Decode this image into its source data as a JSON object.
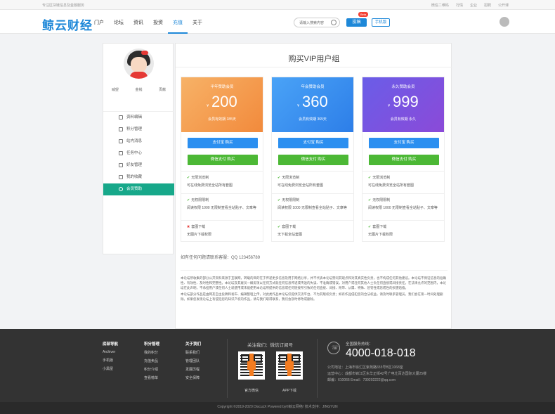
{
  "topbar": {
    "tagline": "专注区块链信息及金融服务",
    "links": [
      "微信二维码",
      "行情",
      "企业",
      "招聘",
      "公开课"
    ]
  },
  "nav": {
    "logo": "鲸云财经",
    "items": [
      "门户",
      "论坛",
      "资讯",
      "投资",
      "充值",
      "关于"
    ],
    "active": "充值",
    "search_placeholder": "请输入搜索内容",
    "post": "投稿",
    "beta": "Beta",
    "mobile": "手机版"
  },
  "sidebar": {
    "stats": [
      "威望",
      "金钱",
      "贡献"
    ],
    "menu": [
      "资料编辑",
      "积分管理",
      "站内消息",
      "任务中心",
      "好友管理",
      "我的收藏",
      "会员赞助"
    ],
    "active": "会员赞助"
  },
  "main": {
    "title": "购买VIP用户组",
    "cards": [
      {
        "name": "半年赞助会员",
        "currency": "¥",
        "price": "200",
        "sub": "会员有效期 185天",
        "alipay": "支付宝 购买",
        "wechat": "微信支付 购买",
        "features": [
          {
            "ok": true,
            "head": "无限浏览制",
            "desc": "可在线免费浏览全站所有套图"
          },
          {
            "ok": true,
            "head": "无权限限制",
            "desc": "阅读权限 1000 无限制查看全站贴子、文章等"
          },
          {
            "ok": false,
            "head": "套图下载",
            "desc": "无图片下载权限"
          }
        ]
      },
      {
        "name": "年会赞助会员",
        "currency": "¥",
        "price": "360",
        "sub": "会员有效期 365天",
        "alipay": "支付宝 购买",
        "wechat": "微信支付 购买",
        "features": [
          {
            "ok": true,
            "head": "无限浏览制",
            "desc": "可在线免费浏览全站所有套图"
          },
          {
            "ok": true,
            "head": "无权限限制",
            "desc": "阅读权限 1000 无限制查看全站贴子、文章等"
          },
          {
            "ok": true,
            "head": "套图下载",
            "desc": "无下载全站套图"
          }
        ]
      },
      {
        "name": "永久赞助会员",
        "currency": "¥",
        "price": "999",
        "sub": "会员有效期 永久",
        "alipay": "支付宝 购买",
        "wechat": "微信支付 购买",
        "features": [
          {
            "ok": true,
            "head": "无限浏览制",
            "desc": "可在线免费浏览全站所有套图"
          },
          {
            "ok": true,
            "head": "无权限限制",
            "desc": "阅读权限 1000 无限制查看全站贴子、文章等"
          },
          {
            "ok": true,
            "head": "套图下载",
            "desc": "无图片下载权限"
          }
        ]
      }
    ],
    "contact": "如有任何问题请联系客服：QQ 123456789",
    "note1": "本论坛所收集的部分公开资料来源于互联网，转载的目的在于传递更多信息及用于网络分享，并不代表本论坛赞同其观点和对其真实性负责，也不构成任何其他建议。本论坛不保证信息的准确性、有效性、及时性和完整性。本论坛及其雇员一概毋须以任何方式就任何信息传递或传送的失误、不准确或错误，对用户或任何其他人士负任何直接或间接责任。在法律允许的范围内，本论坛在此声明，不承担用户或任何人士就使用或未能使用本论坛所提供的信息或任何链接所引致的任何直接、间接、附带、从属、特殊、惩罚性或惩戒性的损害赔偿。",
    "note2": "本论坛部分作品是由网友自主投稿和发布、编辑整理上传，对此类作品本论坛仅提供交流平台，不为其版权负责；如有作品侵犯您的合法权益，请及时联系管理员，我们会在第一时间处理删除。如果您发现论坛上有侵犯您的知识产权的作品，请与我们取得联系，我们会及时修改或删除。"
  },
  "footer": {
    "cols": [
      {
        "title": "底部导航",
        "items": [
          "Archiver",
          "手机版",
          "小黑屋"
        ]
      },
      {
        "title": "积分管理",
        "items": [
          "我的积分",
          "充值卖品",
          "积分介绍",
          "查看榜单"
        ]
      },
      {
        "title": "关于我们",
        "items": [
          "联系我们",
          "管理团队",
          "发展历程",
          "安全保障"
        ]
      }
    ],
    "follow": "关注我们：微信订阅号",
    "qr_labels": [
      "官方微信",
      "APP下载"
    ],
    "service_label": "全国服务热线：",
    "tel": "4000-018-018",
    "addr": [
      "公司地址：上海市徐汇区紫苑路655号B区1068室",
      "运营中心：成都市锦江区东华正街42号广电仕百达国际大厦25楼",
      "邮编：610066 Email：739202222@qq.com"
    ],
    "copyright": "Copyright ©2019-2020  DiscuzX  Powered by©鲸云网络! 技术支持：JINGYUN"
  }
}
